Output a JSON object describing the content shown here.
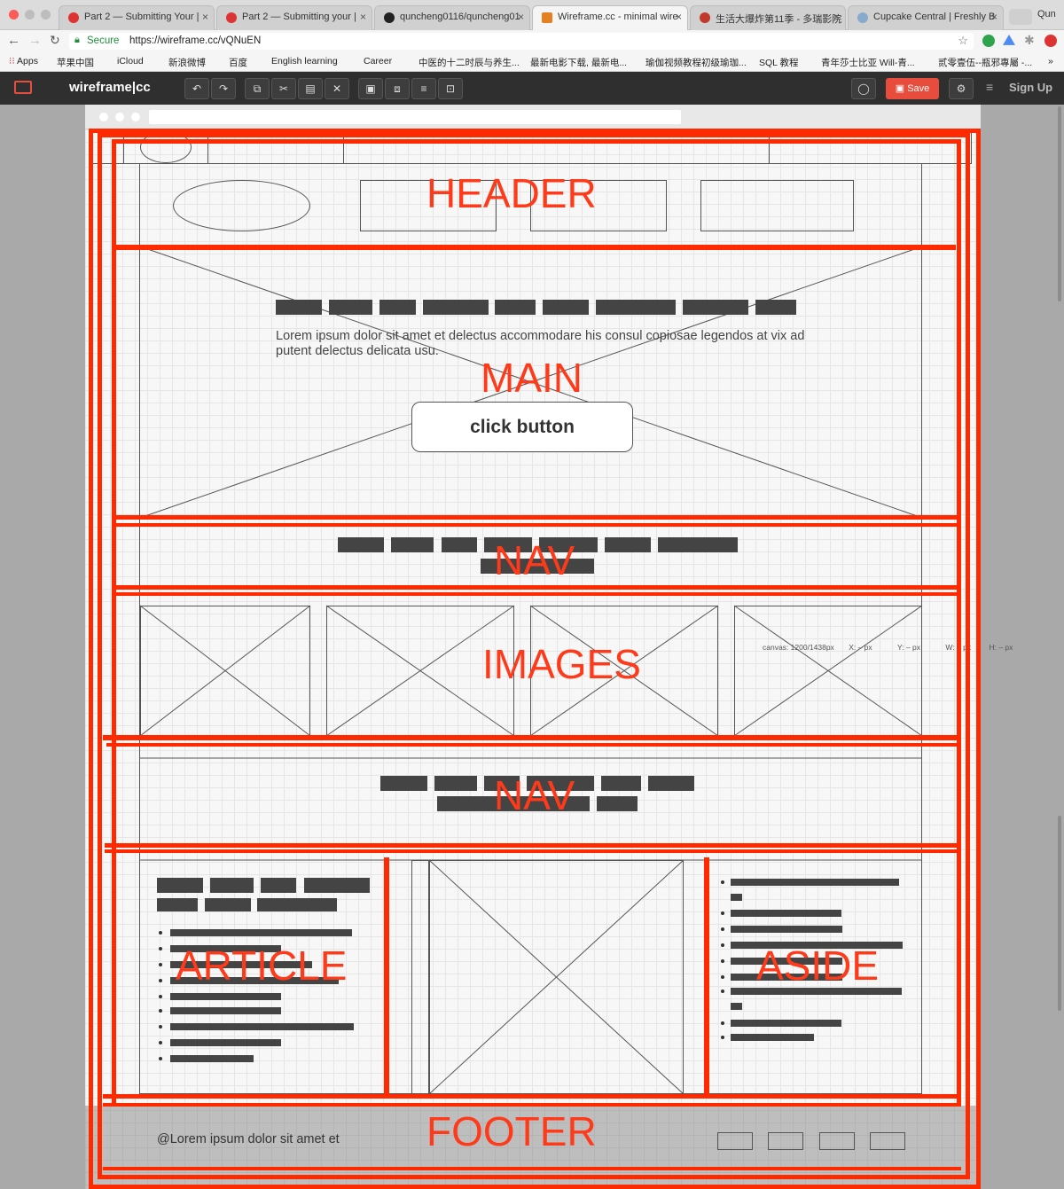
{
  "browser": {
    "tabs": [
      {
        "title": "Part 2 — Submitting Your |"
      },
      {
        "title": "Part 2 — Submitting your |"
      },
      {
        "title": "quncheng0116/quncheng01"
      },
      {
        "title": "Wireframe.cc - minimal wire"
      },
      {
        "title": "生活大爆炸第11季 - 多瑞影院"
      },
      {
        "title": "Cupcake Central | Freshly B"
      }
    ],
    "profile": "Qun",
    "secure_label": "Secure",
    "url": "https://wireframe.cc/vQNuEN",
    "bookmarks": [
      "Apps",
      "苹果中国",
      "iCloud",
      "新浪微博",
      "百度",
      "English learning",
      "Career",
      "中医的十二时辰与养生...",
      "最新电影下载, 最新电...",
      "瑜伽视频教程初级瑜珈...",
      "SQL 教程",
      "青年莎士比亚 Will-青...",
      "贰零壹伍--瓶邪專屬 -..."
    ]
  },
  "app": {
    "logo": "wireframe|cc",
    "save_label": "Save",
    "signup_label": "Sign Up"
  },
  "canvas": {
    "main_text": "Lorem ipsum dolor sit amet et delectus accommodare his consul copiosae legendos at vix ad putent delectus delicata usu.",
    "button_label": "click button",
    "footer_text": "@Lorem ipsum dolor sit amet et",
    "status": {
      "canvas": "canvas: 1200/1438px",
      "x": "X: – px",
      "y": "Y: – px",
      "w": "W: – px",
      "h": "H: – px"
    }
  },
  "annotations": {
    "header": "HEADER",
    "main": "MAIN",
    "nav1": "NAV",
    "images": "IMAGES",
    "nav2": "NAV",
    "article": "ARTICLE",
    "aside": "ASIDE",
    "footer": "FOOTER",
    "color": "#ff2a00"
  }
}
